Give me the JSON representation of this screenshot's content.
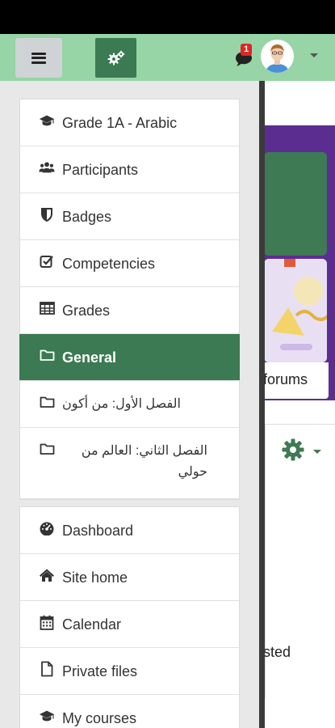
{
  "navbar": {
    "menu_toggle": "menu-toggle",
    "course_admin": "gear-cluster",
    "messages": {
      "badge_count": "1"
    },
    "user_menu": "avatar"
  },
  "drawer": {
    "course_nav": [
      {
        "icon": "graduation-cap-icon",
        "label": "Grade 1A - Arabic"
      },
      {
        "icon": "users-icon",
        "label": "Participants"
      },
      {
        "icon": "shield-icon",
        "label": "Badges"
      },
      {
        "icon": "check-square-icon",
        "label": "Competencies"
      },
      {
        "icon": "table-icon",
        "label": "Grades"
      },
      {
        "icon": "folder-icon",
        "label": "General",
        "active": true
      },
      {
        "icon": "folder-icon",
        "label": "الفصل الأول: من أكون"
      },
      {
        "icon": "folder-icon",
        "label": "الفصل الثاني: العالم من حولي"
      }
    ],
    "site_nav": [
      {
        "icon": "dashboard-icon",
        "label": "Dashboard"
      },
      {
        "icon": "home-icon",
        "label": "Site home"
      },
      {
        "icon": "calendar-icon",
        "label": "Calendar"
      },
      {
        "icon": "file-icon",
        "label": "Private files"
      },
      {
        "icon": "graduation-cap-icon",
        "label": "My courses"
      }
    ]
  },
  "background": {
    "forums_text": "forums",
    "sted_text": "sted"
  },
  "colors": {
    "navbar": "#97d4a6",
    "brand_green": "#3b7a52",
    "banner_purple": "#5c2d91",
    "badge_red": "#e02525"
  }
}
